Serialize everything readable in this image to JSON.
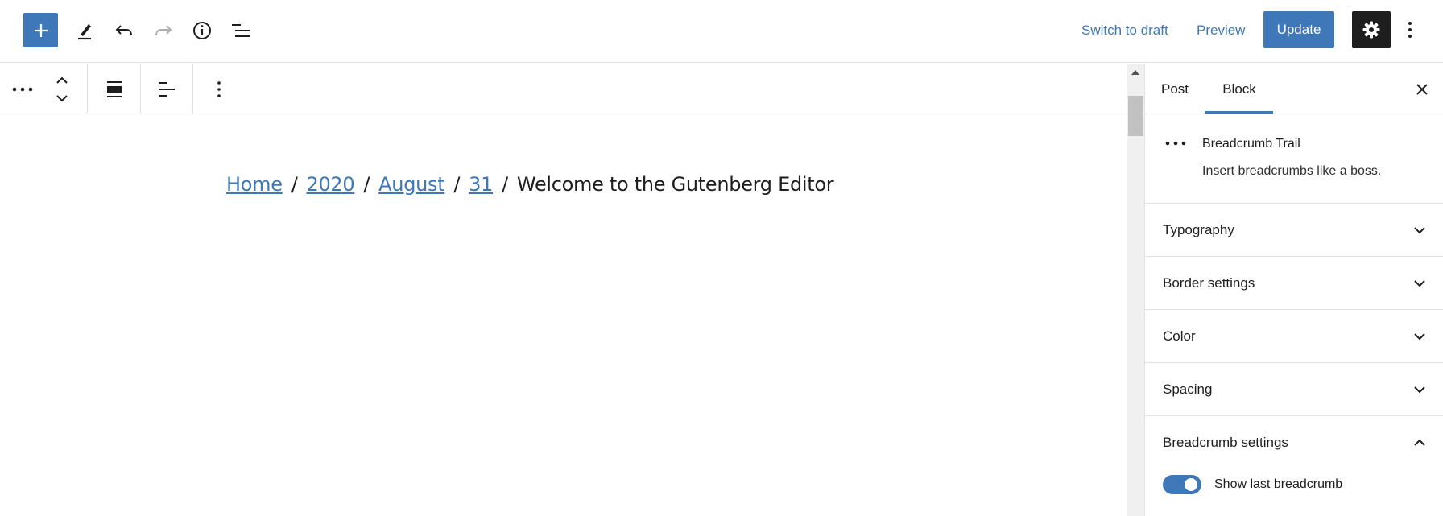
{
  "header": {
    "add_block_label": "+",
    "switch_to_draft": "Switch to draft",
    "preview": "Preview",
    "update": "Update"
  },
  "icons": {
    "add": "plus-icon",
    "tools": "pencil-icon",
    "undo": "undo-icon",
    "redo": "redo-icon",
    "details": "info-icon",
    "outline": "list-view-icon",
    "settings": "gear-icon",
    "options": "vertical-ellipsis-icon"
  },
  "block_toolbar": {
    "items": [
      "block-type-icon",
      "move-up-down-icon",
      "align-wide-icon",
      "align-left-icon",
      "more-options-icon"
    ]
  },
  "content": {
    "breadcrumbs": [
      {
        "label": "Home",
        "link": true
      },
      {
        "label": "2020",
        "link": true
      },
      {
        "label": "August",
        "link": true
      },
      {
        "label": "31",
        "link": true
      },
      {
        "label": "Welcome to the Gutenberg Editor",
        "link": false
      }
    ],
    "separator": "/"
  },
  "sidebar": {
    "tabs": [
      {
        "label": "Post",
        "active": false
      },
      {
        "label": "Block",
        "active": true
      }
    ],
    "block": {
      "title": "Breadcrumb Trail",
      "description": "Insert breadcrumbs like a boss."
    },
    "panels": [
      {
        "title": "Typography",
        "expanded": false
      },
      {
        "title": "Border settings",
        "expanded": false
      },
      {
        "title": "Color",
        "expanded": false
      },
      {
        "title": "Spacing",
        "expanded": false
      },
      {
        "title": "Breadcrumb settings",
        "expanded": true
      }
    ],
    "toggle": {
      "label": "Show last breadcrumb",
      "checked": true
    }
  },
  "colors": {
    "accent": "#3e78b9",
    "dark": "#1e1e1e",
    "border": "#e0e0e0"
  }
}
